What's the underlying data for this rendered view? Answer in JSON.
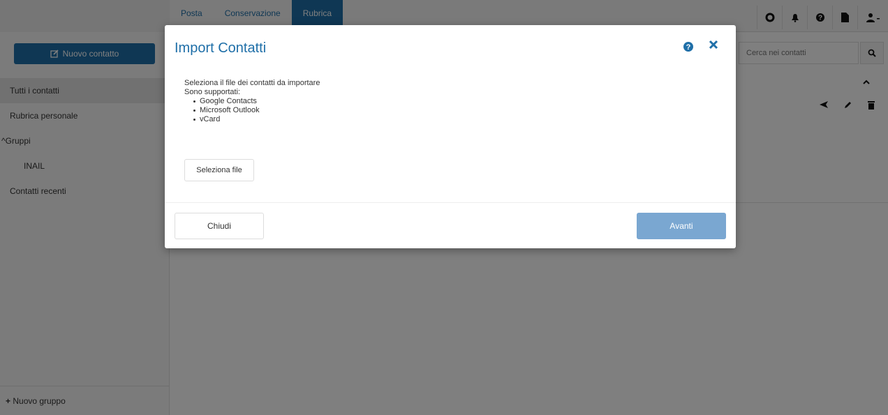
{
  "app": {
    "nav_tabs": [
      "Posta",
      "Conservazione",
      "Rubrica"
    ],
    "active_tab": "Rubrica",
    "top_icons": [
      "settings-icon",
      "bell-icon",
      "help-icon",
      "document-icon",
      "user-icon"
    ]
  },
  "sidebar": {
    "new_contact_label": "Nuovo contatto",
    "items": [
      {
        "label": "Tutti i contatti",
        "active": true
      },
      {
        "label": "Rubrica personale"
      },
      {
        "label": "Gruppi"
      },
      {
        "label": "INAIL"
      },
      {
        "label": "Contatti recenti"
      }
    ],
    "new_group_label": "Nuovo gruppo"
  },
  "content": {
    "search_placeholder": "Cerca nei contatti",
    "row_action_icons": [
      "send-icon",
      "edit-icon",
      "trash-icon"
    ]
  },
  "modal": {
    "title": "Import Contatti",
    "intro_line1": "Seleziona il file dei contatti da importare",
    "intro_line2": "Sono supportati:",
    "formats": [
      "Google Contacts",
      "Microsoft Outlook",
      "vCard"
    ],
    "select_file_label": "Seleziona file",
    "close_label": "Chiudi",
    "next_label": "Avanti"
  },
  "colors": {
    "brand_blue": "#1f6fa8",
    "next_button": "#7aa7d1",
    "overlay": "rgba(0,0,0,0.5)"
  }
}
